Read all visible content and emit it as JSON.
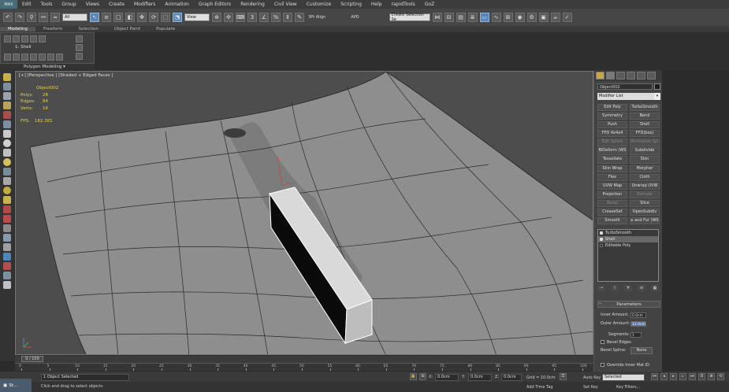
{
  "app": {
    "icon_label": "MAX"
  },
  "menu": [
    "Edit",
    "Tools",
    "Group",
    "Views",
    "Create",
    "Modifiers",
    "Animation",
    "Graph Editors",
    "Rendering",
    "Civil View",
    "Customize",
    "Scripting",
    "Help",
    "rapidTools",
    "GoZ"
  ],
  "toolbar": {
    "selection_filter": "All",
    "ref_coord": "View",
    "align_label": "3Pt Align",
    "apd_label": "APD",
    "named_selection": "Create Selection Se"
  },
  "ribbon": {
    "tabs": [
      "Modeling",
      "Freeform",
      "Selection",
      "Object Paint",
      "Populate"
    ],
    "active_tab": "Modeling",
    "current_modifier": "1: Shell",
    "footer": "Polygon Modeling"
  },
  "viewport": {
    "label": "[+] [Perspective ] [Shaded + Edged Faces ]",
    "object_name": "Object002",
    "stats": [
      {
        "key": "Polys:",
        "value": "28"
      },
      {
        "key": "Edges:",
        "value": "84"
      },
      {
        "key": "Verts:",
        "value": "16"
      }
    ],
    "fps_label": "FPS:",
    "fps_value": "182.381"
  },
  "command_panel": {
    "object_name": "Object002",
    "modifier_list": "Modifier List",
    "modifier_buttons": [
      {
        "label": "Edit Poly",
        "dim": false
      },
      {
        "label": "TurboSmooth",
        "dim": false
      },
      {
        "label": "Symmetry",
        "dim": false
      },
      {
        "label": "Bend",
        "dim": false
      },
      {
        "label": "Push",
        "dim": false
      },
      {
        "label": "Shell",
        "dim": false
      },
      {
        "label": "FFD 4x4x4",
        "dim": false
      },
      {
        "label": "FFD(box)",
        "dim": false
      },
      {
        "label": "Edit Spline",
        "dim": true
      },
      {
        "label": "Normalize Spl",
        "dim": true
      },
      {
        "label": "BiDeform (WS",
        "dim": false
      },
      {
        "label": "Subdivide",
        "dim": false
      },
      {
        "label": "Tessellate",
        "dim": false
      },
      {
        "label": "Skin",
        "dim": false
      },
      {
        "label": "Skin Wrap",
        "dim": false
      },
      {
        "label": "Morpher",
        "dim": false
      },
      {
        "label": "Flex",
        "dim": false
      },
      {
        "label": "Cloth",
        "dim": false
      },
      {
        "label": "UVW Map",
        "dim": false
      },
      {
        "label": "Unwrap UVW",
        "dim": false
      },
      {
        "label": "Projection",
        "dim": false
      },
      {
        "label": "Extrude",
        "dim": true
      },
      {
        "label": "Bevel",
        "dim": true
      },
      {
        "label": "Slice",
        "dim": false
      },
      {
        "label": "CreaseSet",
        "dim": false
      },
      {
        "label": "OpenSubdiv",
        "dim": false
      },
      {
        "label": "Smooth",
        "dim": false
      },
      {
        "label": "e and Fur (WS",
        "dim": false
      }
    ],
    "stack": [
      {
        "label": "TurboSmooth",
        "selected": false
      },
      {
        "label": "Shell",
        "selected": true
      },
      {
        "label": "Editable Poly",
        "selected": false
      }
    ],
    "params_title": "Parameters",
    "inner_amount_label": "Inner Amount:",
    "inner_amount": "0.0cm",
    "outer_amount_label": "Outer Amount:",
    "outer_amount": "12.0cm",
    "segments_label": "Segments:",
    "segments": "1",
    "bevel_edges_label": "Bevel Edges",
    "bevel_spline_label": "Bevel Spline:",
    "bevel_spline_value": "None",
    "override_label": "Override Inner Mat ID"
  },
  "timeline": {
    "frame_display": "0 / 100",
    "ticks": [
      "0",
      "5",
      "10",
      "15",
      "20",
      "25",
      "30",
      "35",
      "40",
      "45",
      "50",
      "55",
      "60",
      "65",
      "70",
      "75",
      "80",
      "85",
      "90",
      "95",
      "100"
    ]
  },
  "status": {
    "taskbar_label": "St...",
    "selection_info": "1 Object Selected",
    "prompt": "Click and drag to select objects",
    "x_value": "0.0cm",
    "y_value": "0.0cm",
    "z_value": "0.0cm",
    "grid": "Grid = 10.0cm",
    "add_time_tag": "Add Time Tag",
    "auto_key": "Auto Key",
    "set_key": "Set Key",
    "key_mode": "Selected",
    "key_filters": "Key Filters..."
  }
}
